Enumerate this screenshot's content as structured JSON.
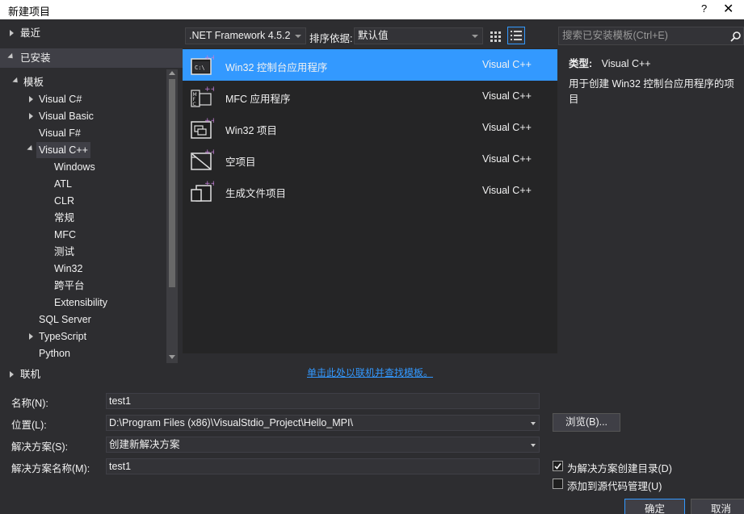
{
  "window": {
    "title": "新建项目",
    "help": "?",
    "close": "✕"
  },
  "tree": {
    "recent": "最近",
    "installed": "已安装",
    "templates": "模板",
    "items": [
      {
        "label": "Visual C#"
      },
      {
        "label": "Visual Basic"
      },
      {
        "label": "Visual F#"
      },
      {
        "label": "Visual C++"
      },
      {
        "label": "Windows"
      },
      {
        "label": "ATL"
      },
      {
        "label": "CLR"
      },
      {
        "label": "常规"
      },
      {
        "label": "MFC"
      },
      {
        "label": "测试"
      },
      {
        "label": "Win32"
      },
      {
        "label": "跨平台"
      },
      {
        "label": "Extensibility"
      },
      {
        "label": "SQL Server"
      },
      {
        "label": "TypeScript"
      },
      {
        "label": "Python"
      }
    ],
    "online": "联机"
  },
  "toolbar": {
    "framework": ".NET Framework 4.5.2",
    "sort_label": "排序依据:",
    "sort_value": "默认值"
  },
  "search": {
    "placeholder": "搜索已安装模板(Ctrl+E)"
  },
  "templates": [
    {
      "name": "Win32 控制台应用程序",
      "lang": "Visual C++",
      "icon": "console-app-icon"
    },
    {
      "name": "MFC 应用程序",
      "lang": "Visual C++",
      "icon": "mfc-app-icon"
    },
    {
      "name": "Win32 项目",
      "lang": "Visual C++",
      "icon": "win32-project-icon"
    },
    {
      "name": "空项目",
      "lang": "Visual C++",
      "icon": "empty-project-icon"
    },
    {
      "name": "生成文件项目",
      "lang": "Visual C++",
      "icon": "makefile-project-icon"
    }
  ],
  "details": {
    "type_label": "类型:",
    "type_value": "Visual C++",
    "description": "用于创建 Win32 控制台应用程序的项目"
  },
  "online_link": "单击此处以联机并查找模板。",
  "form": {
    "name_label": "名称(N):",
    "name_value": "test1",
    "location_label": "位置(L):",
    "location_value": "D:\\Program Files (x86)\\VisualStdio_Project\\Hello_MPI\\",
    "browse": "浏览(B)...",
    "solution_label": "解决方案(S):",
    "solution_value": "创建新解决方案",
    "solution_name_label": "解决方案名称(M):",
    "solution_name_value": "test1",
    "create_dir": "为解决方案创建目录(D)",
    "add_source_control": "添加到源代码管理(U)"
  },
  "buttons": {
    "ok": "确定",
    "cancel": "取消"
  }
}
